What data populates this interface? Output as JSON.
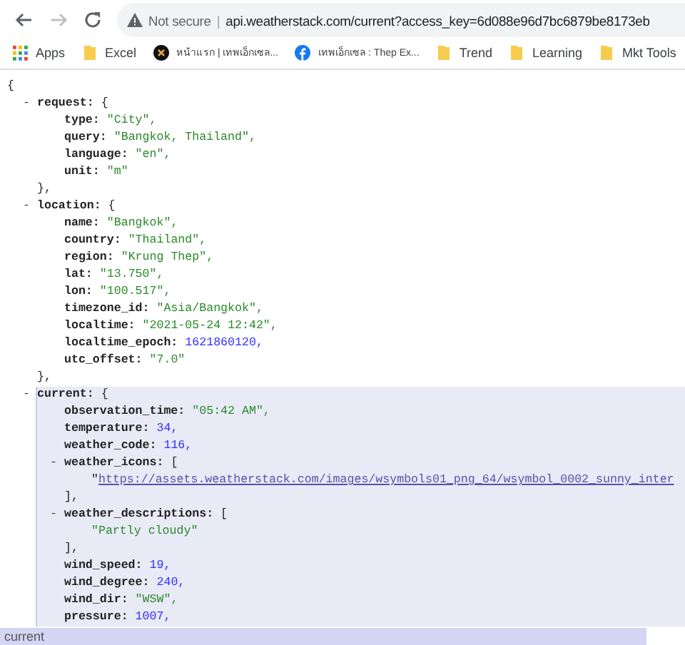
{
  "omnibox": {
    "security": "Not secure",
    "separator": "|",
    "url": "api.weatherstack.com/current?access_key=6d088e96d7bc6879be8173eb"
  },
  "bookmarks": [
    {
      "label": "Apps",
      "kind": "apps"
    },
    {
      "label": "Excel",
      "kind": "folder"
    },
    {
      "label": "หน้าแรก | เทพเอ็กเซล...",
      "kind": "site"
    },
    {
      "label": "เทพเอ็กเซล : Thep Ex...",
      "kind": "facebook"
    },
    {
      "label": "Trend",
      "kind": "folder"
    },
    {
      "label": "Learning",
      "kind": "folder"
    },
    {
      "label": "Mkt Tools",
      "kind": "folder"
    }
  ],
  "json_view": {
    "open": "{",
    "nodes": [
      {
        "toggle": "-",
        "key": "request:",
        "open": "{",
        "close": "},",
        "selected": false,
        "children": [
          {
            "key": "type:",
            "value": "\"City\",",
            "kind": "string"
          },
          {
            "key": "query:",
            "value": "\"Bangkok, Thailand\",",
            "kind": "string"
          },
          {
            "key": "language:",
            "value": "\"en\",",
            "kind": "string"
          },
          {
            "key": "unit:",
            "value": "\"m\"",
            "kind": "string"
          }
        ]
      },
      {
        "toggle": "-",
        "key": "location:",
        "open": "{",
        "close": "},",
        "selected": false,
        "children": [
          {
            "key": "name:",
            "value": "\"Bangkok\",",
            "kind": "string"
          },
          {
            "key": "country:",
            "value": "\"Thailand\",",
            "kind": "string"
          },
          {
            "key": "region:",
            "value": "\"Krung Thep\",",
            "kind": "string"
          },
          {
            "key": "lat:",
            "value": "\"13.750\",",
            "kind": "string"
          },
          {
            "key": "lon:",
            "value": "\"100.517\",",
            "kind": "string"
          },
          {
            "key": "timezone_id:",
            "value": "\"Asia/Bangkok\",",
            "kind": "string"
          },
          {
            "key": "localtime:",
            "value": "\"2021-05-24 12:42\",",
            "kind": "string"
          },
          {
            "key": "localtime_epoch:",
            "value": "1621860120,",
            "kind": "number"
          },
          {
            "key": "utc_offset:",
            "value": "\"7.0\"",
            "kind": "string"
          }
        ]
      },
      {
        "toggle": "-",
        "key": "current:",
        "open": "{",
        "selected": true,
        "children": [
          {
            "key": "observation_time:",
            "value": "\"05:42 AM\",",
            "kind": "string"
          },
          {
            "key": "temperature:",
            "value": "34,",
            "kind": "number"
          },
          {
            "key": "weather_code:",
            "value": "116,",
            "kind": "number"
          },
          {
            "toggle": "-",
            "key": "weather_icons:",
            "open": "[",
            "close": "],",
            "selected": false,
            "children": [
              {
                "kind": "link",
                "quote": "\"",
                "value": "https://assets.weatherstack.com/images/wsymbols01_png_64/wsymbol_0002_sunny_inter"
              }
            ]
          },
          {
            "toggle": "-",
            "key": "weather_descriptions:",
            "open": "[",
            "close": "],",
            "selected": false,
            "children": [
              {
                "value": "\"Partly cloudy\"",
                "kind": "string"
              }
            ]
          },
          {
            "key": "wind_speed:",
            "value": "19,",
            "kind": "number"
          },
          {
            "key": "wind_degree:",
            "value": "240,",
            "kind": "number"
          },
          {
            "key": "wind_dir:",
            "value": "\"WSW\",",
            "kind": "string"
          },
          {
            "key": "pressure:",
            "value": "1007,",
            "kind": "number"
          }
        ]
      }
    ]
  },
  "status_bar": "current"
}
